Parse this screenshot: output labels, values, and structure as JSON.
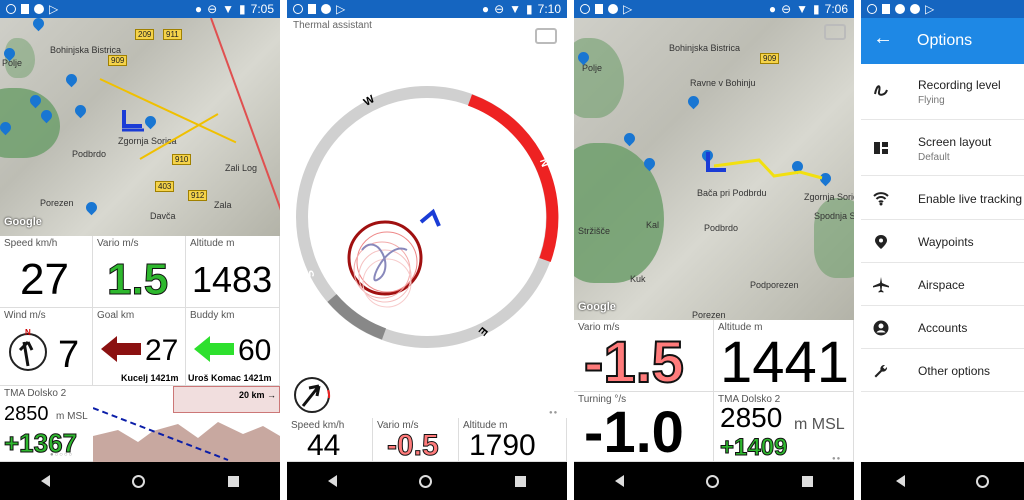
{
  "status": {
    "time_1": "7:05",
    "time_2": "7:10",
    "time_3": "7:06"
  },
  "screen1": {
    "map": {
      "labels": [
        "Bohinjska Bistrica",
        "Polje",
        "Podbrdo",
        "Zgornja Sorica",
        "Zali Log",
        "Porezen",
        "Davča",
        "Zala"
      ],
      "road_badges": [
        "209",
        "911",
        "909",
        "910",
        "403",
        "912"
      ]
    },
    "tiles": {
      "speed": {
        "label": "Speed km/h",
        "value": "27"
      },
      "vario": {
        "label": "Vario m/s",
        "value": "1.5"
      },
      "altitude": {
        "label": "Altitude m",
        "value": "1483"
      },
      "wind": {
        "label": "Wind m/s",
        "value": "7",
        "compass_n": "N"
      },
      "goal": {
        "label": "Goal km",
        "value": "27",
        "name": "Kucelj 1421m"
      },
      "buddy": {
        "label": "Buddy km",
        "value": "60",
        "name": "Uroš Komac 1421m"
      },
      "airspace": {
        "label": "TMA Dolsko 2",
        "value": "2850",
        "unit": "m MSL",
        "delta": "+1367",
        "distance": "20 km →"
      }
    }
  },
  "screen2": {
    "title": "Thermal assistant",
    "compass": {
      "n": "N",
      "e": "E",
      "s": "S",
      "w": "W"
    },
    "tiles": {
      "speed": {
        "label": "Speed km/h",
        "value": "44"
      },
      "vario": {
        "label": "Vario m/s",
        "value": "-0.5"
      },
      "altitude": {
        "label": "Altitude m",
        "value": "1790"
      }
    }
  },
  "screen3": {
    "map": {
      "labels": [
        "Bohinjska Bistrica",
        "Polje",
        "Ravne v Bohinju",
        "Bača pri Podbrdu",
        "Podbrdo",
        "Stržišče",
        "Kal",
        "Kuk",
        "Podporezen",
        "Porezen",
        "Zgornja Sorica",
        "Spodnja S"
      ],
      "road_badges": [
        "909"
      ]
    },
    "tiles": {
      "vario": {
        "label": "Vario m/s",
        "value": "-1.5"
      },
      "altitude": {
        "label": "Altitude m",
        "value": "1441"
      },
      "turning": {
        "label": "Turning °/s",
        "value": "-1.0"
      },
      "airspace": {
        "label": "TMA Dolsko 2",
        "value": "2850",
        "unit": "m MSL",
        "delta": "+1409"
      }
    }
  },
  "screen4": {
    "header": {
      "title": "Options"
    },
    "items": [
      {
        "title": "Recording level",
        "subtitle": "Flying",
        "icon": "recording-icon"
      },
      {
        "title": "Screen layout",
        "subtitle": "Default",
        "icon": "layout-icon"
      },
      {
        "title": "Enable live tracking",
        "subtitle": "",
        "icon": "wifi-icon"
      },
      {
        "title": "Waypoints",
        "subtitle": "",
        "icon": "location-pin-icon"
      },
      {
        "title": "Airspace",
        "subtitle": "",
        "icon": "airplane-icon"
      },
      {
        "title": "Accounts",
        "subtitle": "",
        "icon": "account-icon"
      },
      {
        "title": "Other options",
        "subtitle": "",
        "icon": "wrench-icon"
      }
    ]
  },
  "colors": {
    "accent": "#1e88e5",
    "status": "#1565c0",
    "positive": "#2eb82e",
    "negative": "#ff7b7b",
    "thermal": "#e53935"
  }
}
